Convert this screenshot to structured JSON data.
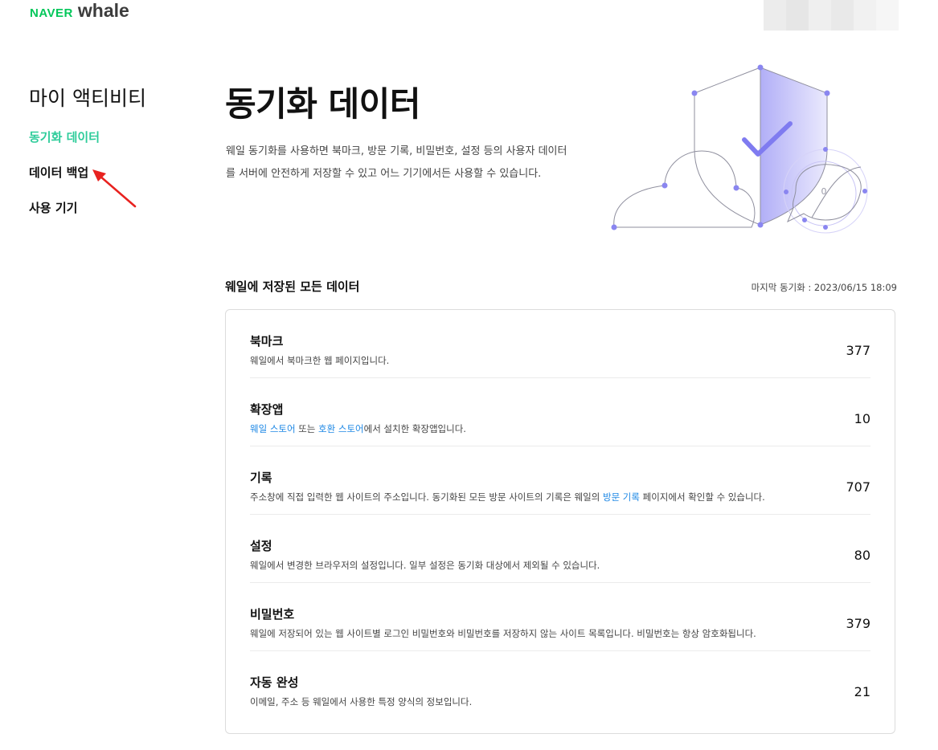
{
  "brand": {
    "naver": "NAVER",
    "whale": "whale",
    "naver_color": "#03c75a",
    "whale_color": "#3c3c3c"
  },
  "sidebar": {
    "title": "마이 액티비티",
    "items": [
      {
        "label": "동기화 데이터",
        "active": true,
        "color": "#2ecc9a"
      },
      {
        "label": "데이터 백업",
        "active": false
      },
      {
        "label": "사용 기기",
        "active": false
      }
    ]
  },
  "main": {
    "title": "동기화 데이터",
    "description_line1": "웨일 동기화를 사용하면 북마크, 방문 기록, 비밀번호, 설정 등의 사용자 데이터",
    "description_line2": "를 서버에 안전하게 저장할 수 있고 어느 기기에서든 사용할 수 있습니다.",
    "hero_icon": "shield-check-cloud-illustration",
    "hero_counter": "0"
  },
  "section": {
    "title": "웨일에 저장된 모든 데이터",
    "last_sync_label": "마지막 동기화 : 2023/06/15 18:09"
  },
  "data_rows": [
    {
      "title": "북마크",
      "desc_parts": [
        {
          "text": "웨일에서 북마크한 웹 페이지입니다.",
          "link": false
        }
      ],
      "count": "377"
    },
    {
      "title": "확장앱",
      "desc_parts": [
        {
          "text": "웨일 스토어",
          "link": true
        },
        {
          "text": " 또는 ",
          "link": false
        },
        {
          "text": "호환 스토어",
          "link": true
        },
        {
          "text": "에서 설치한 확장앱입니다.",
          "link": false
        }
      ],
      "count": "10"
    },
    {
      "title": "기록",
      "desc_parts": [
        {
          "text": "주소창에 직접 입력한 웹 사이트의 주소입니다. 동기화된 모든 방문 사이트의 기록은 웨일의 ",
          "link": false
        },
        {
          "text": "방문 기록",
          "link": true
        },
        {
          "text": " 페이지에서 확인할 수 있습니다.",
          "link": false
        }
      ],
      "count": "707"
    },
    {
      "title": "설정",
      "desc_parts": [
        {
          "text": "웨일에서 변경한 브라우저의 설정입니다. 일부 설정은 동기화 대상에서 제외될 수 있습니다.",
          "link": false
        }
      ],
      "count": "80"
    },
    {
      "title": "비밀번호",
      "desc_parts": [
        {
          "text": "웨일에 저장되어 있는 웹 사이트별 로그인 비밀번호와 비밀번호를 저장하지 않는 사이트 목록입니다. 비밀번호는 항상 암호화됩니다.",
          "link": false
        }
      ],
      "count": "379"
    },
    {
      "title": "자동 완성",
      "desc_parts": [
        {
          "text": "이메일, 주소 등 웨일에서 사용한 특정 양식의 정보입니다.",
          "link": false
        }
      ],
      "count": "21"
    }
  ],
  "colors": {
    "accent_green": "#2ecc9a",
    "link_blue": "#1e88e5",
    "hero_purple": "#8a86f0",
    "annotation_red": "#e8221f"
  }
}
